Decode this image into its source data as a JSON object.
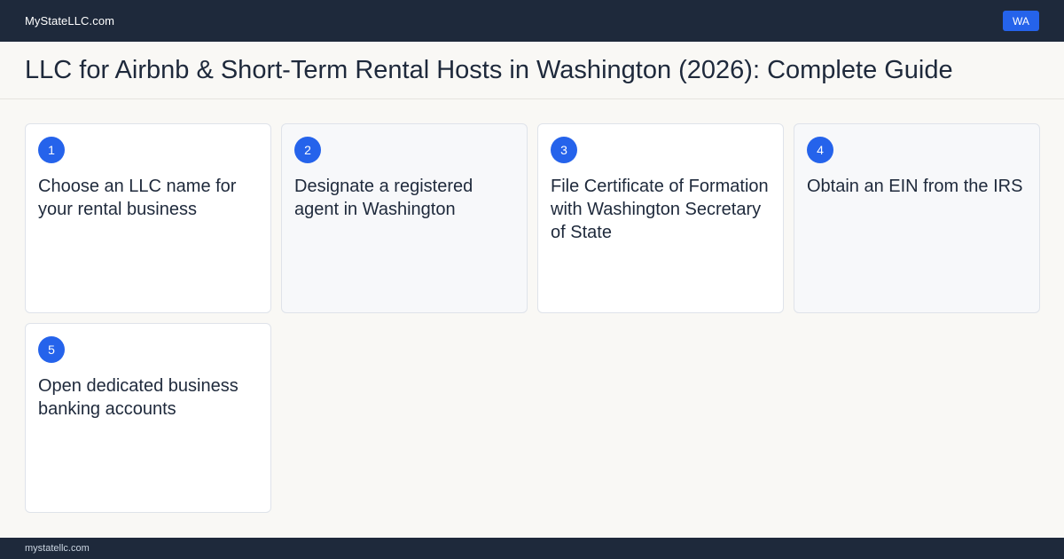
{
  "header": {
    "brand": "MyStateLLC.com",
    "state_badge": "WA"
  },
  "page": {
    "title": "LLC for Airbnb & Short-Term Rental Hosts in Washington (2026): Complete Guide"
  },
  "steps": [
    {
      "number": "1",
      "text": "Choose an LLC name for your rental business"
    },
    {
      "number": "2",
      "text": "Designate a registered agent in Washington"
    },
    {
      "number": "3",
      "text": "File Certificate of Formation with Washington Secretary of State"
    },
    {
      "number": "4",
      "text": "Obtain an EIN from the IRS"
    },
    {
      "number": "5",
      "text": "Open dedicated business banking accounts"
    }
  ],
  "footer": {
    "domain": "mystatellc.com"
  },
  "colors": {
    "navy": "#1e293b",
    "accent": "#2563eb",
    "background": "#f9f8f5"
  }
}
